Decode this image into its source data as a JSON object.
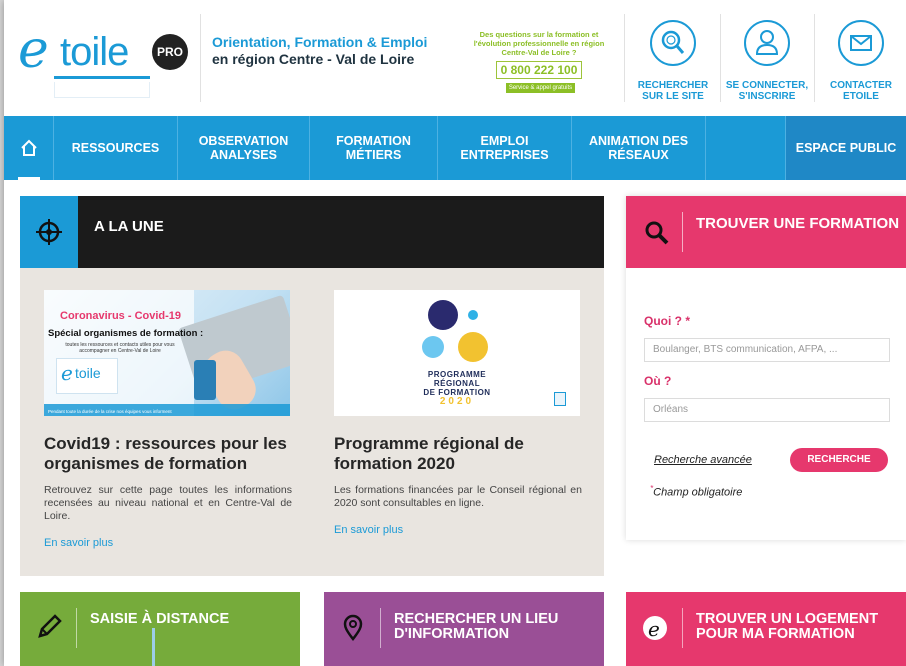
{
  "header": {
    "logo_letter": "e",
    "logo_word": "toile",
    "logo_badge": "PRO",
    "tagline_line1": "Orientation, Formation & Emploi",
    "tagline_line2": "en région Centre - Val de Loire",
    "hotline_question": "Des questions sur la formation et l'évolution professionnelle en région Centre-Val de Loire ?",
    "hotline_number": "0 800 222 100",
    "hotline_badge": "Service & appel gratuits",
    "buttons": [
      {
        "label": "RECHERCHER SUR LE SITE",
        "icon": "search-icon"
      },
      {
        "label": "SE CONNECTER, S'INSCRIRE",
        "icon": "user-icon"
      },
      {
        "label": "CONTACTER ETOILE",
        "icon": "mail-icon"
      }
    ]
  },
  "nav": {
    "items": [
      "RESSOURCES",
      "OBSERVATION ANALYSES",
      "FORMATION MÉTIERS",
      "EMPLOI ENTREPRISES",
      "ANIMATION DES RÉSEAUX",
      "ESPACE PUBLIC"
    ]
  },
  "une": {
    "title": "A LA UNE",
    "cards": [
      {
        "thumb_title": "Coronavirus - Covid-19",
        "thumb_sub": "Spécial organismes de formation :",
        "thumb_small": "toutes les ressources et contacts utiles pour vous accompagner en Centre-Val de Loire",
        "thumb_footer": "Pendant toute la durée de la crise nos équipes vous informent",
        "title": "Covid19 : ressources pour les organismes de formation",
        "text": "Retrouvez sur cette page toutes les informations recensées au niveau national et en Centre-Val de Loire.",
        "link": "En savoir plus"
      },
      {
        "thumb_line1": "PROGRAMME",
        "thumb_line2": "RÉGIONAL",
        "thumb_line3": "DE FORMATION",
        "thumb_year": "2020",
        "title": "Programme régional de formation 2020",
        "text": "Les formations financées par le Conseil régional en 2020 sont consultables en ligne.",
        "link": "En savoir plus"
      }
    ]
  },
  "search": {
    "title": "TROUVER UNE FORMATION",
    "quoi_label": "Quoi ?",
    "required_mark": "*",
    "quoi_placeholder": "Boulanger, BTS communication, AFPA, ...",
    "ou_label": "Où ?",
    "ou_placeholder": "Orléans",
    "advanced": "Recherche avancée",
    "submit": "RECHERCHE",
    "mandatory_note": "Champ obligatoire"
  },
  "tiles": [
    {
      "title": "SAISIE À DISTANCE",
      "color": "#76ab3b",
      "icon": "pencil-icon"
    },
    {
      "title": "RECHERCHER UN LIEU D'INFORMATION",
      "color": "#9a4f96",
      "icon": "location-pin-icon"
    },
    {
      "title": "TROUVER UN LOGEMENT POUR MA FORMATION",
      "color": "#e6386d",
      "icon": "etoile-e-icon"
    }
  ],
  "colors": {
    "primary_blue": "#1b9ad6",
    "pink": "#e6386d",
    "green": "#76ab3b",
    "purple": "#9a4f96"
  }
}
